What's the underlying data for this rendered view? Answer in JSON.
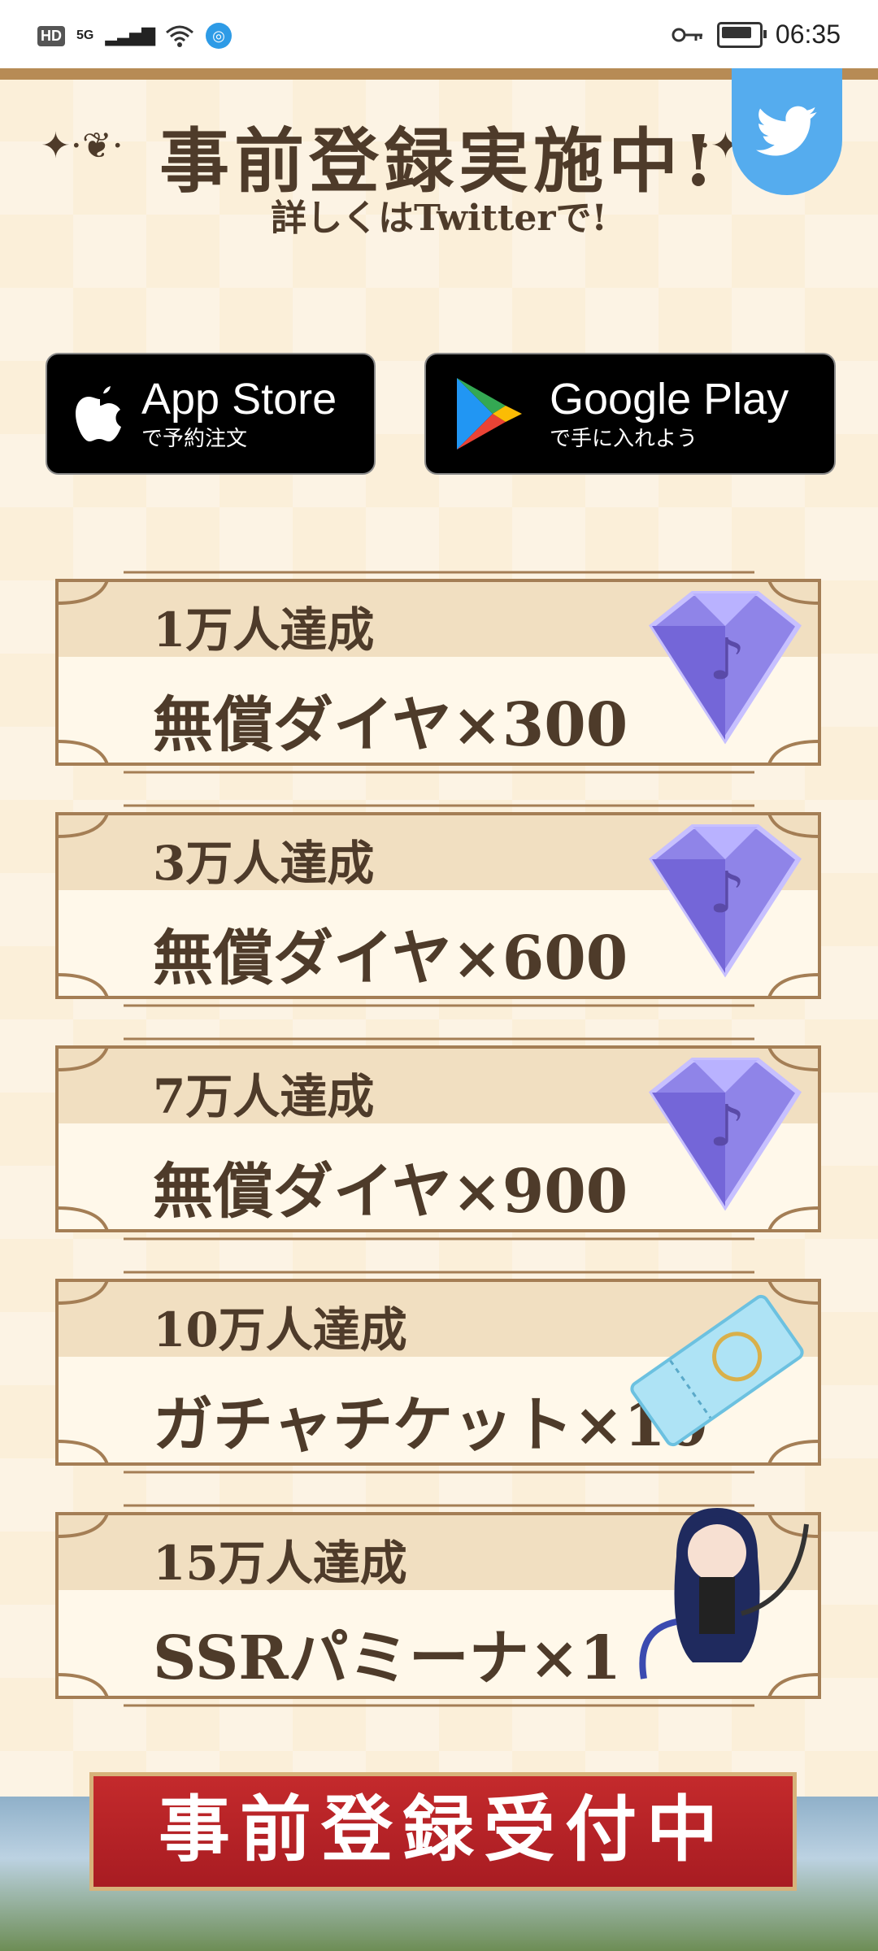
{
  "status_bar": {
    "network_badge": "HD",
    "network_type": "5G",
    "time": "06:35"
  },
  "header": {
    "title": "事前登録実施中!",
    "subtitle": "詳しくはTwitterで!"
  },
  "store_buttons": {
    "app_store": {
      "title": "App Store",
      "subtitle": "で予約注文"
    },
    "google_play": {
      "title": "Google Play",
      "subtitle": "で手に入れよう"
    }
  },
  "rewards": [
    {
      "condition": "1万人達成",
      "reward": "無償ダイヤ×300"
    },
    {
      "condition": "3万人達成",
      "reward": "無償ダイヤ×600"
    },
    {
      "condition": "7万人達成",
      "reward": "無償ダイヤ×900"
    },
    {
      "condition": "10万人達成",
      "reward": "ガチャチケット×10"
    },
    {
      "condition": "15万人達成",
      "reward": "SSRパミーナ×1"
    }
  ],
  "bottom_banner": {
    "title": "事前登録受付中"
  },
  "colors": {
    "background": "#fbefd9",
    "text_brown": "#4e3b2a",
    "frame_brown": "#a47e55",
    "twitter_blue": "#55acee",
    "banner_red": "#b5222a"
  }
}
